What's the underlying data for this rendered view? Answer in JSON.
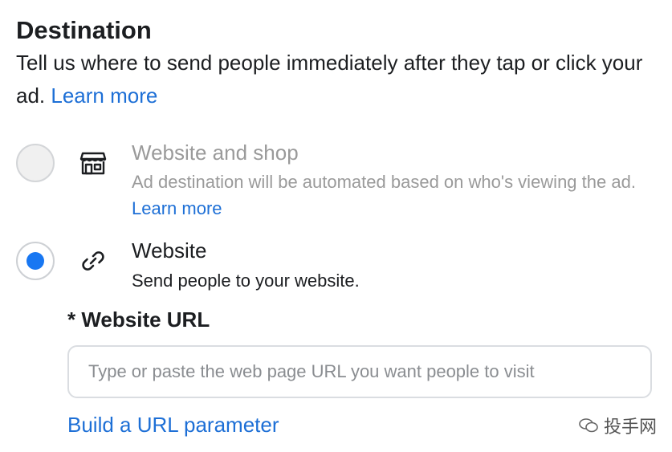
{
  "header": {
    "title": "Destination",
    "description": "Tell us where to send people immediately after they tap or click your ad.",
    "learn_more": "Learn more"
  },
  "options": [
    {
      "icon": "storefront-icon",
      "title": "Website and shop",
      "description": "Ad destination will be automated based on who's viewing the ad.",
      "learn_more": "Learn more",
      "selected": false,
      "disabled": true
    },
    {
      "icon": "link-icon",
      "title": "Website",
      "description": "Send people to your website.",
      "selected": true,
      "disabled": false
    }
  ],
  "url_field": {
    "label": "* Website URL",
    "value": "",
    "placeholder": "Type or paste the web page URL you want people to visit"
  },
  "build_link": "Build a URL parameter",
  "watermark": {
    "text": "投手网"
  },
  "colors": {
    "accent": "#1877f2",
    "link": "#1d6fd6",
    "muted_text": "#9a9a9a"
  }
}
